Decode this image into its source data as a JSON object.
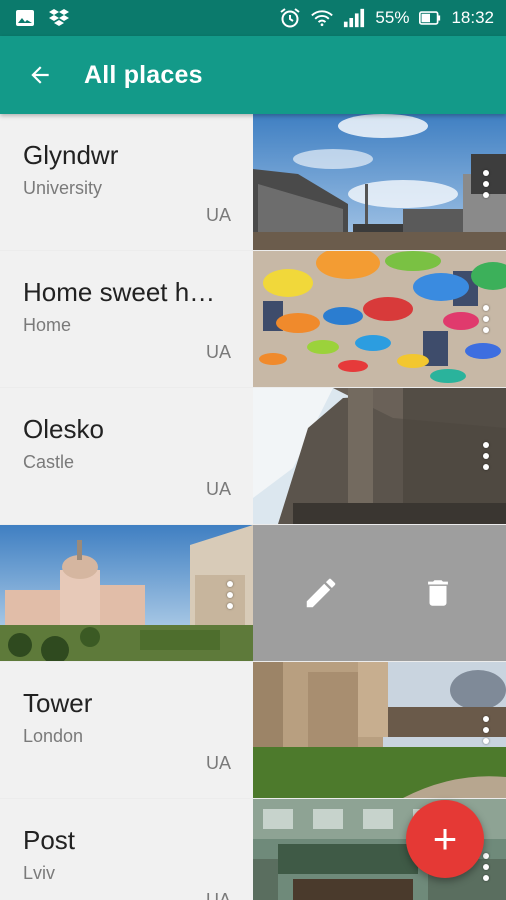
{
  "status_bar": {
    "icons_left": [
      "image-icon",
      "dropbox-icon"
    ],
    "icons_right": [
      "alarm-icon",
      "wifi-icon",
      "signal-icon"
    ],
    "battery": "55%",
    "time": "18:32"
  },
  "app_bar": {
    "title": "All places",
    "back_icon": "arrow-back-icon"
  },
  "places": [
    {
      "name": "Glyndwr",
      "category": "University",
      "country": "UA"
    },
    {
      "name": "Home sweet h…",
      "category": "Home",
      "country": "UA"
    },
    {
      "name": "Olesko",
      "category": "Castle",
      "country": "UA"
    },
    {
      "name": "",
      "category": "",
      "country": ""
    },
    {
      "name": "Tower",
      "category": "London",
      "country": "UA"
    },
    {
      "name": "Post",
      "category": "Lviv",
      "country": "UA"
    }
  ],
  "swipe_actions": {
    "edit_icon": "pencil-icon",
    "delete_icon": "trash-icon"
  },
  "fab": {
    "label": "+",
    "icon": "plus-icon"
  },
  "colors": {
    "status_bar": "#0b7a6c",
    "app_bar": "#139a89",
    "fab": "#e53935",
    "actions_bg": "#9e9e9e"
  }
}
